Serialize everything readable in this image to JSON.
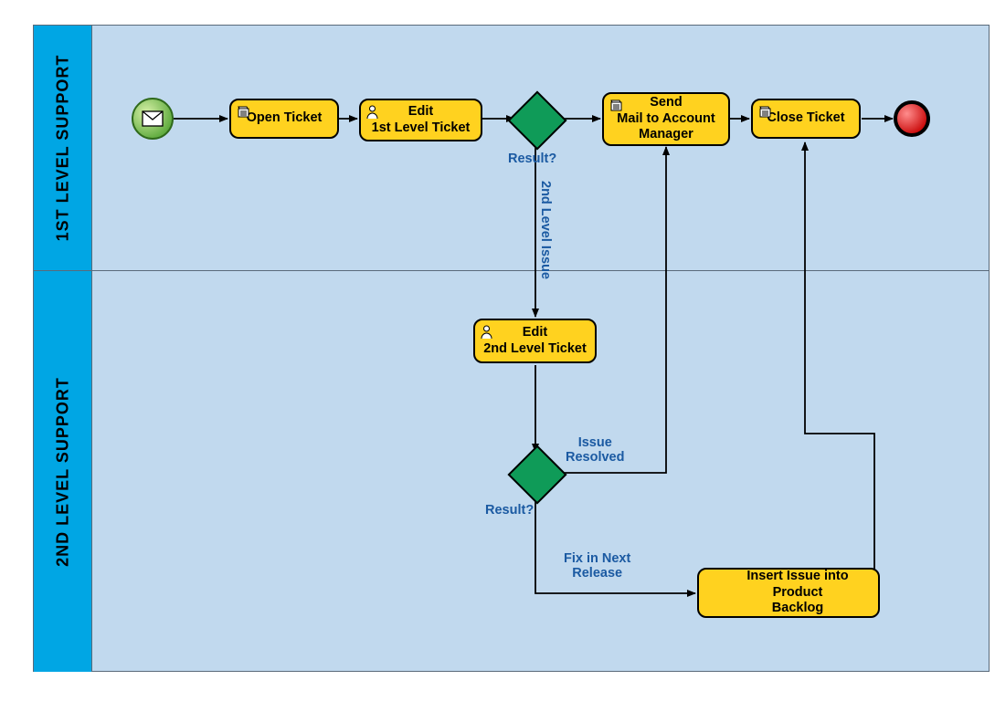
{
  "lanes": {
    "first": "1ST LEVEL SUPPORT",
    "second": "2ND LEVEL SUPPORT"
  },
  "tasks": {
    "open": "Open Ticket",
    "edit1": "Edit\n1st Level Ticket",
    "send": "Send\nMail to Account\nManager",
    "close": "Close Ticket",
    "edit2": "Edit\n2nd Level Ticket",
    "backlog": "Insert Issue into Product\nBacklog"
  },
  "labels": {
    "result": "Result?",
    "second_level": "2nd Level Issue",
    "issue_resolved": "Issue\nResolved",
    "fix_next": "Fix in Next\nRelease"
  }
}
